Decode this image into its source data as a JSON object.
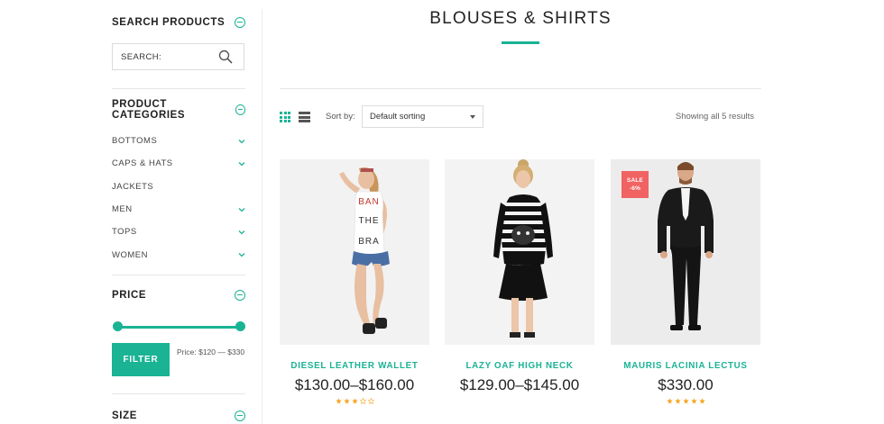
{
  "sidebar": {
    "search_title": "SEARCH PRODUCTS",
    "search_label": "SEARCH:",
    "categories_title": "PRODUCT CATEGORIES",
    "categories": [
      {
        "label": "BOTTOMS",
        "has_children": true
      },
      {
        "label": "CAPS & HATS",
        "has_children": true
      },
      {
        "label": "JACKETS",
        "has_children": false
      },
      {
        "label": "MEN",
        "has_children": true
      },
      {
        "label": "TOPS",
        "has_children": true
      },
      {
        "label": "WOMEN",
        "has_children": true
      }
    ],
    "price_title": "PRICE",
    "filter_label": "FILTER",
    "price_range": "Price: $120 — $330",
    "size_title": "SIZE"
  },
  "main": {
    "title": "BLOUSES & SHIRTS",
    "sort_label": "Sort by:",
    "sort_value": "Default sorting",
    "results_text": "Showing all 5 results"
  },
  "products": [
    {
      "name": "DIESEL LEATHER WALLET",
      "price": "$130.00–$160.00",
      "rating": 3,
      "sale": false
    },
    {
      "name": "LAZY OAF HIGH NECK",
      "price": "$129.00–$145.00",
      "rating": 0,
      "sale": false
    },
    {
      "name": "MAURIS LACINIA LECTUS",
      "price": "$330.00",
      "rating": 5,
      "sale": true,
      "sale_label": "SALE",
      "sale_percent": "-6%"
    }
  ],
  "tshirt_text": [
    "BAN",
    "THE",
    "BRA"
  ],
  "colors": {
    "accent": "#1ab394",
    "sale": "#f16262",
    "star": "#f5a623"
  }
}
